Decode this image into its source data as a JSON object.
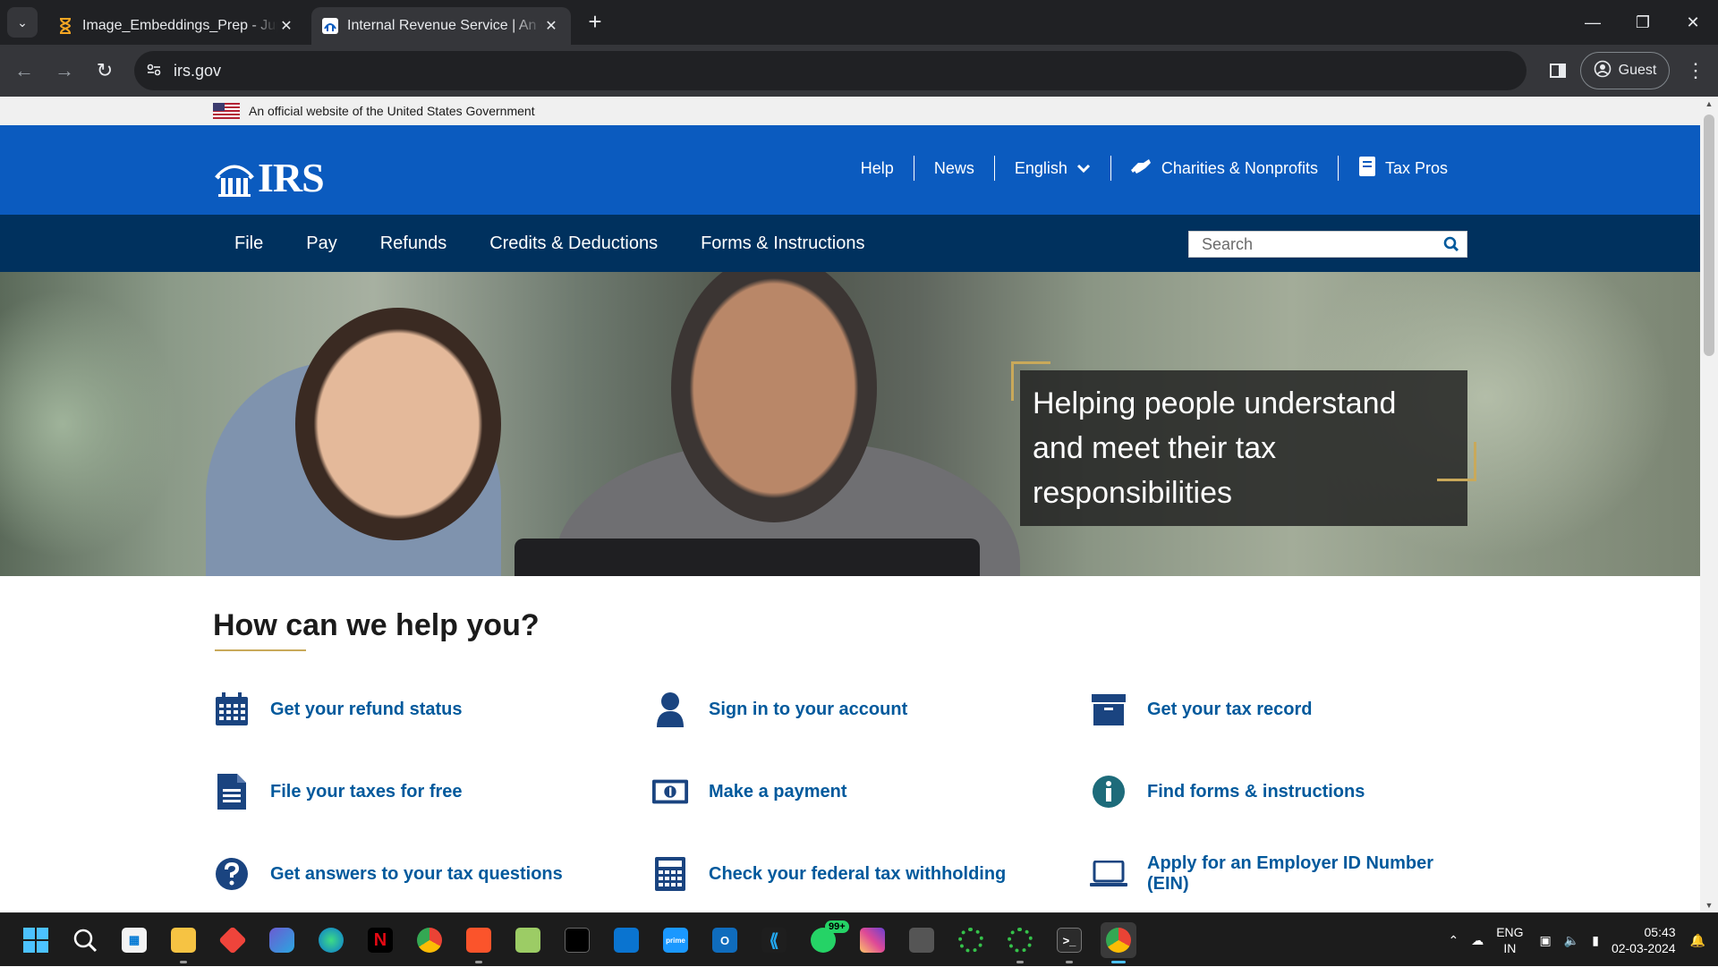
{
  "browser": {
    "tabs": [
      {
        "label": "Image_Embeddings_Prep - Jupyter",
        "active": false,
        "icon": "hourglass-icon"
      },
      {
        "label": "Internal Revenue Service | An official website",
        "active": true,
        "icon": "irs-favicon"
      }
    ],
    "url": "irs.gov",
    "profile_label": "Guest"
  },
  "gov_banner": {
    "text": "An official website of the United States Government"
  },
  "header": {
    "logo_text": "IRS",
    "utility_nav": [
      {
        "label": "Help"
      },
      {
        "label": "News"
      },
      {
        "label": "English"
      },
      {
        "label": "Charities & Nonprofits"
      },
      {
        "label": "Tax Pros"
      }
    ]
  },
  "main_nav": {
    "items": [
      {
        "label": "File"
      },
      {
        "label": "Pay"
      },
      {
        "label": "Refunds"
      },
      {
        "label": "Credits & Deductions"
      },
      {
        "label": "Forms & Instructions"
      }
    ],
    "search_placeholder": "Search"
  },
  "hero": {
    "caption": "Helping people understand and meet their tax responsibilities"
  },
  "help": {
    "title": "How can we help you?",
    "links": [
      {
        "label": "Get your refund status",
        "icon": "calendar-icon"
      },
      {
        "label": "Sign in to your account",
        "icon": "user-icon"
      },
      {
        "label": "Get your tax record",
        "icon": "archive-box-icon"
      },
      {
        "label": "File your taxes for free",
        "icon": "document-icon"
      },
      {
        "label": "Make a payment",
        "icon": "money-bill-icon"
      },
      {
        "label": "Find forms & instructions",
        "icon": "info-icon"
      },
      {
        "label": "Get answers to your tax questions",
        "icon": "question-icon"
      },
      {
        "label": "Check your federal tax withholding",
        "icon": "calculator-icon"
      },
      {
        "label": "Apply for an Employer ID Number (EIN)",
        "icon": "laptop-icon"
      }
    ]
  },
  "taskbar": {
    "whatsapp_badge": "99+",
    "language": "ENG",
    "region": "IN",
    "time": "05:43",
    "date": "02-03-2024"
  },
  "colors": {
    "irs_blue": "#0b5bbf",
    "irs_navy": "#00315e",
    "link_blue": "#00599c",
    "gold_accent": "#c9a95a"
  }
}
